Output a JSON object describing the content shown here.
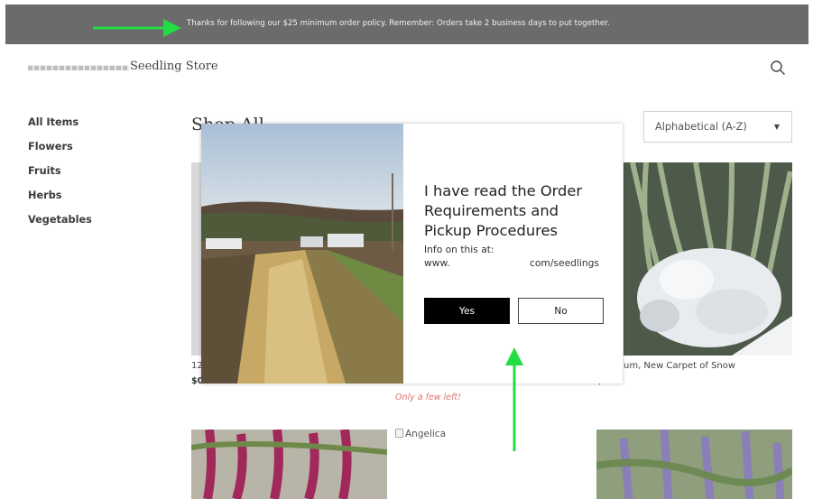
{
  "banner": {
    "text": "Thanks for following our $25 minimum order policy. Remember: Orders take 2 business days to put together."
  },
  "header": {
    "store_name": "Seedling Store",
    "search_icon": "search-icon"
  },
  "sidebar": {
    "items": [
      {
        "label": "All Items"
      },
      {
        "label": "Flowers"
      },
      {
        "label": "Fruits"
      },
      {
        "label": "Herbs"
      },
      {
        "label": "Vegetables"
      }
    ]
  },
  "main": {
    "title": "Shop All",
    "sort": {
      "selected": "Alphabetical (A-Z)"
    },
    "products": [
      {
        "caption": "12",
        "price": "$0"
      },
      {
        "caption": "",
        "price": "",
        "status": "Only a few left!"
      },
      {
        "caption": "um, New Carpet of Snow",
        "price": "$"
      },
      {
        "caption": "Angelica"
      }
    ]
  },
  "modal": {
    "heading": "I have read the Order Requirements and Pickup Procedures",
    "info": "Info on this at:",
    "url_prefix": "www.",
    "url_suffix": "com/seedlings",
    "yes_label": "Yes",
    "no_label": "No"
  },
  "colors": {
    "banner_bg": "#6b6b6b",
    "annotation_arrow": "#22dd44",
    "low_stock": "#e07070",
    "primary_button": "#000000"
  }
}
